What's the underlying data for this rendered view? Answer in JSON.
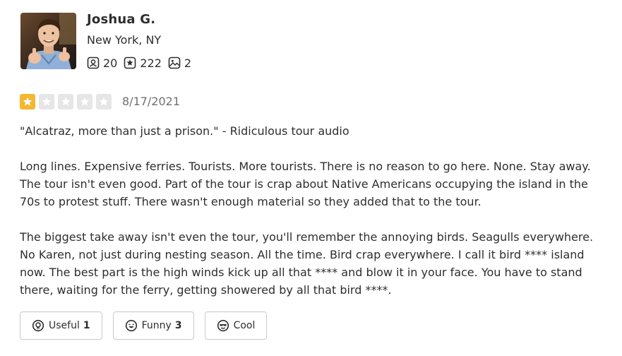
{
  "user": {
    "name": "Joshua G.",
    "location": "New York, NY",
    "stats": {
      "friends": "20",
      "reviews": "222",
      "photos": "2"
    }
  },
  "review": {
    "rating": 1,
    "rating_max": 5,
    "date": "8/17/2021",
    "paragraphs": [
      "\"Alcatraz, more than just a prison.\" - Ridiculous tour audio",
      "Long lines. Expensive ferries. Tourists. More tourists. There is no reason to go here. None. Stay away. The tour isn't even good. Part of the tour is crap about Native Americans occupying the island in the 70s to protest stuff. There wasn't enough material so they added that to the tour.",
      "The biggest take away isn't even the tour, you'll remember the annoying birds. Seagulls everywhere. No Karen, not just during nesting season. All the time. Bird crap everywhere. I call it bird **** island now. The best part is the high winds kick up all that **** and blow it in your face. You have to stand there, waiting for the ferry, getting showered by all that bird ****."
    ]
  },
  "reactions": {
    "useful": {
      "label": "Useful",
      "count": "1"
    },
    "funny": {
      "label": "Funny",
      "count": "3"
    },
    "cool": {
      "label": "Cool",
      "count": ""
    }
  },
  "colors": {
    "star_filled": "#f5b731",
    "star_empty": "#e6e6e6",
    "text": "#2d2e2f",
    "muted": "#6e7072",
    "border": "#c8c9ca"
  }
}
